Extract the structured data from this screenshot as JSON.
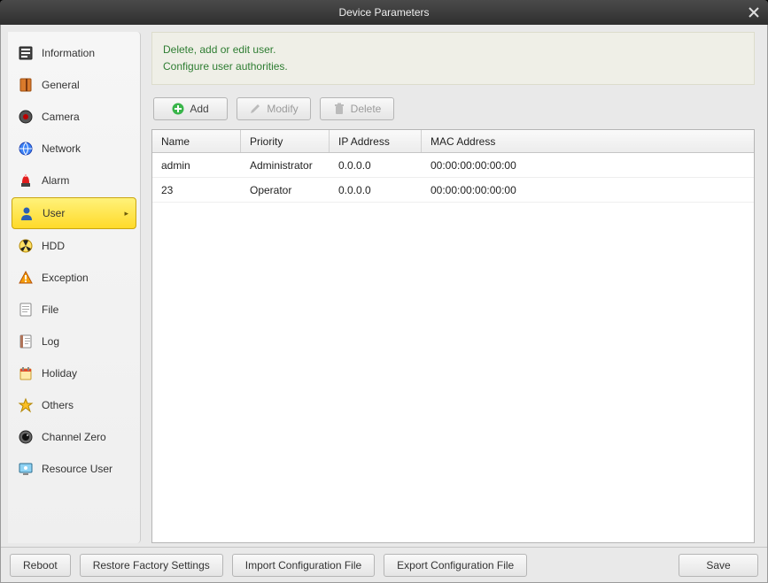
{
  "window": {
    "title": "Device Parameters"
  },
  "sidebar": {
    "items": [
      {
        "id": "information",
        "label": "Information",
        "active": false
      },
      {
        "id": "general",
        "label": "General",
        "active": false
      },
      {
        "id": "camera",
        "label": "Camera",
        "active": false
      },
      {
        "id": "network",
        "label": "Network",
        "active": false
      },
      {
        "id": "alarm",
        "label": "Alarm",
        "active": false
      },
      {
        "id": "user",
        "label": "User",
        "active": true
      },
      {
        "id": "hdd",
        "label": "HDD",
        "active": false
      },
      {
        "id": "exception",
        "label": "Exception",
        "active": false
      },
      {
        "id": "file",
        "label": "File",
        "active": false
      },
      {
        "id": "log",
        "label": "Log",
        "active": false
      },
      {
        "id": "holiday",
        "label": "Holiday",
        "active": false
      },
      {
        "id": "others",
        "label": "Others",
        "active": false
      },
      {
        "id": "channel-zero",
        "label": "Channel Zero",
        "active": false
      },
      {
        "id": "resource-user",
        "label": "Resource User",
        "active": false
      }
    ]
  },
  "help": {
    "line1": "Delete, add or edit user.",
    "line2": "Configure user authorities."
  },
  "toolbar": {
    "add": "Add",
    "modify": "Modify",
    "delete": "Delete"
  },
  "table": {
    "headers": {
      "name": "Name",
      "priority": "Priority",
      "ip": "IP Address",
      "mac": "MAC Address"
    },
    "rows": [
      {
        "name": "admin",
        "priority": "Administrator",
        "ip": "0.0.0.0",
        "mac": "00:00:00:00:00:00"
      },
      {
        "name": "23",
        "priority": "Operator",
        "ip": "0.0.0.0",
        "mac": "00:00:00:00:00:00"
      }
    ]
  },
  "footer": {
    "reboot": "Reboot",
    "restore": "Restore Factory Settings",
    "importcfg": "Import Configuration File",
    "exportcfg": "Export Configuration File",
    "save": "Save"
  }
}
